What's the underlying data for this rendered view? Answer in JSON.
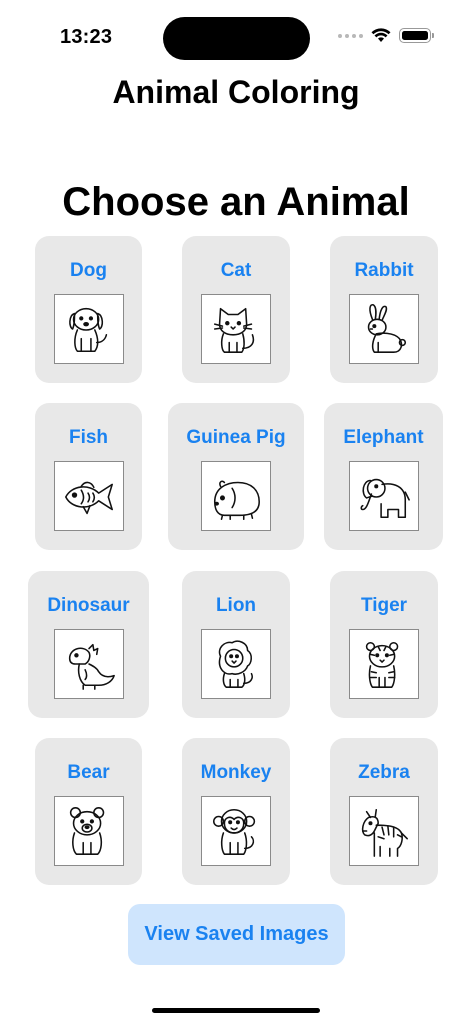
{
  "status_bar": {
    "time": "13:23"
  },
  "nav": {
    "title": "Animal Coloring"
  },
  "main": {
    "heading": "Choose an Animal"
  },
  "animals": [
    {
      "label": "Dog",
      "icon": "dog-outline-icon"
    },
    {
      "label": "Cat",
      "icon": "cat-outline-icon"
    },
    {
      "label": "Rabbit",
      "icon": "rabbit-outline-icon"
    },
    {
      "label": "Fish",
      "icon": "fish-outline-icon"
    },
    {
      "label": "Guinea Pig",
      "icon": "guinea-pig-outline-icon"
    },
    {
      "label": "Elephant",
      "icon": "elephant-outline-icon"
    },
    {
      "label": "Dinosaur",
      "icon": "dinosaur-outline-icon"
    },
    {
      "label": "Lion",
      "icon": "lion-outline-icon"
    },
    {
      "label": "Tiger",
      "icon": "tiger-outline-icon"
    },
    {
      "label": "Bear",
      "icon": "bear-outline-icon"
    },
    {
      "label": "Monkey",
      "icon": "monkey-outline-icon"
    },
    {
      "label": "Zebra",
      "icon": "zebra-outline-icon"
    }
  ],
  "actions": {
    "view_saved_label": "View Saved Images"
  },
  "colors": {
    "accent": "#1a82f0",
    "card_bg": "#e8e8e8",
    "button_bg": "#cfe5fd"
  }
}
